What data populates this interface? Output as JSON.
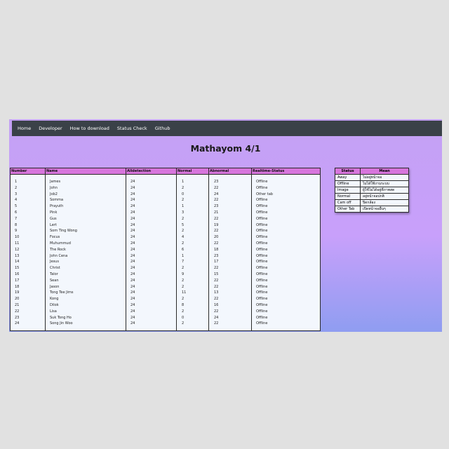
{
  "nav": {
    "items": [
      "Home",
      "Developer",
      "How to download",
      "Status Check",
      "Github"
    ]
  },
  "page": {
    "title": "Mathayom 4/1"
  },
  "table": {
    "headers": [
      "Number",
      "Name",
      "Alldetection",
      "Normal",
      "Abnormal",
      "Realtime-Status"
    ],
    "rows": [
      [
        "1",
        "James",
        "24",
        "1",
        "23",
        "Offline"
      ],
      [
        "2",
        "John",
        "24",
        "2",
        "22",
        "Offline"
      ],
      [
        "3",
        "Job2",
        "24",
        "0",
        "24",
        "Other tab"
      ],
      [
        "4",
        "Somma",
        "24",
        "2",
        "22",
        "Offline"
      ],
      [
        "5",
        "Prayuth",
        "24",
        "1",
        "23",
        "Offline"
      ],
      [
        "6",
        "Pink",
        "24",
        "3",
        "21",
        "Offline"
      ],
      [
        "7",
        "Gus",
        "24",
        "2",
        "22",
        "Offline"
      ],
      [
        "8",
        "Lert",
        "24",
        "5",
        "19",
        "Offline"
      ],
      [
        "9",
        "Som Ting Wong",
        "24",
        "2",
        "22",
        "Offline"
      ],
      [
        "10",
        "Focus",
        "24",
        "4",
        "20",
        "Offline"
      ],
      [
        "11",
        "Muhummud",
        "24",
        "2",
        "22",
        "Offline"
      ],
      [
        "12",
        "The Rock",
        "24",
        "6",
        "18",
        "Offline"
      ],
      [
        "13",
        "John Cena",
        "24",
        "1",
        "23",
        "Offline"
      ],
      [
        "14",
        "Jesus",
        "24",
        "7",
        "17",
        "Offline"
      ],
      [
        "15",
        "Christ",
        "24",
        "2",
        "22",
        "Offline"
      ],
      [
        "16",
        "Talor",
        "24",
        "9",
        "15",
        "Offline"
      ],
      [
        "17",
        "Sean",
        "24",
        "2",
        "22",
        "Offline"
      ],
      [
        "18",
        "Jason",
        "24",
        "2",
        "22",
        "Offline"
      ],
      [
        "19",
        "Tong Tee Jims",
        "24",
        "11",
        "13",
        "Offline"
      ],
      [
        "20",
        "Kong",
        "24",
        "2",
        "22",
        "Offline"
      ],
      [
        "21",
        "Dilok",
        "24",
        "8",
        "16",
        "Offline"
      ],
      [
        "22",
        "Lisa",
        "24",
        "2",
        "22",
        "Offline"
      ],
      [
        "23",
        "Suk Tong Ho",
        "24",
        "0",
        "24",
        "Offline"
      ],
      [
        "24",
        "Song Jin Woo",
        "24",
        "2",
        "22",
        "Offline"
      ]
    ]
  },
  "legend": {
    "headers": [
      "Status",
      "Mean"
    ],
    "rows": [
      [
        "Away",
        "ไม่อยู่หน้าจอ"
      ],
      [
        "Offline",
        "ไม่ได้ใช้งานระบบ"
      ],
      [
        "Image",
        "ผู้ใช้ไม่ได้อยู่ที่ภาพสด"
      ],
      [
        "Normal",
        "อยู่หน้าจอปกติ"
      ],
      [
        "Cam off",
        "ปิดกล้อง"
      ],
      [
        "Other Tab",
        "เปิดหน้าจออื่นๆ"
      ]
    ]
  },
  "colors": {
    "navbar": "#3a4148",
    "header_accent": "#d775dc",
    "gradient_top": "#c4a1f4",
    "gradient_bottom": "#8f9df1"
  }
}
